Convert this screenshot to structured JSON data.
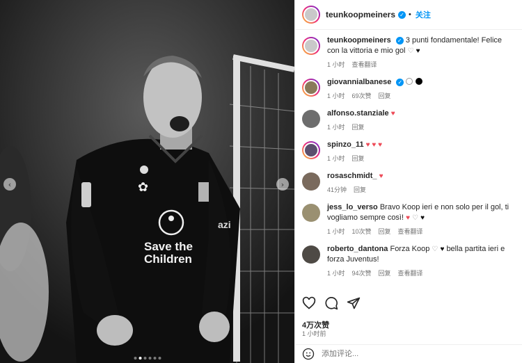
{
  "post": {
    "author": "teunkoopmeiners",
    "follow_label": "关注",
    "separator": "•",
    "caption_text": "3 punti fondamentale! Felice con la vittoria e mio gol",
    "caption_time": "1 小时",
    "caption_translate": "查看翻译"
  },
  "comments": [
    {
      "user": "giovannialbanese",
      "text": "",
      "time": "1 小时",
      "likes": "69次赞",
      "reply": "回复",
      "translate": ""
    },
    {
      "user": "alfonso.stanziale",
      "text": "",
      "time": "1 小时",
      "likes": "",
      "reply": "回复",
      "translate": ""
    },
    {
      "user": "spinzo_11",
      "text": "",
      "time": "1 小时",
      "likes": "",
      "reply": "回复",
      "translate": ""
    },
    {
      "user": "rosaschmidt_",
      "text": "",
      "time": "41分钟",
      "likes": "",
      "reply": "回复",
      "translate": ""
    },
    {
      "user": "jess_lo_verso",
      "text": "Bravo Koop ieri e non solo per il gol, ti vogliamo sempre così!",
      "time": "1 小时",
      "likes": "10次赞",
      "reply": "回复",
      "translate": "查看翻译"
    },
    {
      "user": "roberto_dantona",
      "text": "Forza Koop",
      "text2": "bella partita ieri e forza Juventus!",
      "time": "1 小时",
      "likes": "94次赞",
      "reply": "回复",
      "translate": "查看翻译"
    }
  ],
  "footer": {
    "likes": "4万次赞",
    "time": "1 小时前",
    "comment_placeholder": "添加评论..."
  },
  "photo": {
    "shirt_text_1": "Save the",
    "shirt_text_2": "Children",
    "sponsor_text": "azi"
  },
  "colors": {
    "accent": "#0095f6",
    "heart": "#ed4956",
    "muted": "#737373"
  }
}
